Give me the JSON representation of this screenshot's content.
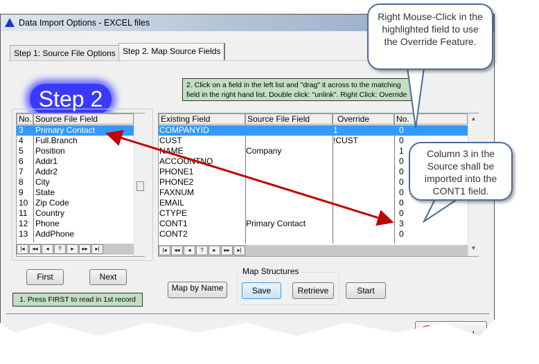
{
  "window": {
    "title": "Data Import Options - EXCEL files"
  },
  "tabs": [
    {
      "label": "Step 1: Source File Options",
      "active": false
    },
    {
      "label": "Step 2. Map Source Fields",
      "active": true
    }
  ],
  "step_banner": "Step 2",
  "instructions_top": [
    "2.  Click on a field in the left list and \"drag\" it across to the matching",
    "field in the right hand list.  Double click: \"unlink\". Right Click: Override"
  ],
  "left_list": {
    "headers": [
      "No.",
      "Source File Field"
    ],
    "rows": [
      [
        "3",
        "Primary Contact"
      ],
      [
        "4",
        "Full.Branch"
      ],
      [
        "5",
        "Position"
      ],
      [
        "6",
        "Addr1"
      ],
      [
        "7",
        "Addr2"
      ],
      [
        "8",
        "City"
      ],
      [
        "9",
        "State"
      ],
      [
        "10",
        "Zip Code"
      ],
      [
        "11",
        "Country"
      ],
      [
        "12",
        "Phone"
      ],
      [
        "13",
        "AddPhone"
      ]
    ],
    "selected": 0
  },
  "right_grid": {
    "headers": [
      "Existing Field",
      "Source File Field",
      "Override",
      "No."
    ],
    "rows": [
      [
        "COMPANYID",
        "",
        "1",
        "0"
      ],
      [
        "CUST",
        "",
        "!CUST",
        "0"
      ],
      [
        "NAME",
        "Company",
        "",
        "1"
      ],
      [
        "ACCOUNTNO",
        "",
        "",
        "0"
      ],
      [
        "PHONE1",
        "",
        "",
        "0"
      ],
      [
        "PHONE2",
        "",
        "",
        "0"
      ],
      [
        "FAXNUM",
        "",
        "",
        "0"
      ],
      [
        "EMAIL",
        "",
        "",
        "0"
      ],
      [
        "CTYPE",
        "",
        "",
        "0"
      ],
      [
        "CONT1",
        "Primary Contact",
        "",
        "3"
      ],
      [
        "CONT2",
        "",
        "",
        "0"
      ]
    ],
    "selected": 0
  },
  "nav_buttons": [
    "|◂",
    "◂◂",
    "◂",
    "?",
    "▸",
    "▸▸",
    "▸|"
  ],
  "buttons": {
    "first": "First",
    "next": "Next",
    "map_by_name": "Map by Name",
    "save": "Save",
    "retrieve": "Retrieve",
    "start": "Start",
    "cancel": "Cancel"
  },
  "group_label": "Map Structures",
  "instructions_bottom": "1. Press FIRST to read in 1st record",
  "callouts": {
    "override": "Right Mouse-Click in the highlighted field to use the Override Feature.",
    "column": "Column 3 in the Source shall be imported into the CONT1 field."
  },
  "colors": {
    "selection": "#3399ff",
    "arrow": "#c00000",
    "green_box": "#c3dfc3",
    "step_glow": "#3a3aff"
  }
}
